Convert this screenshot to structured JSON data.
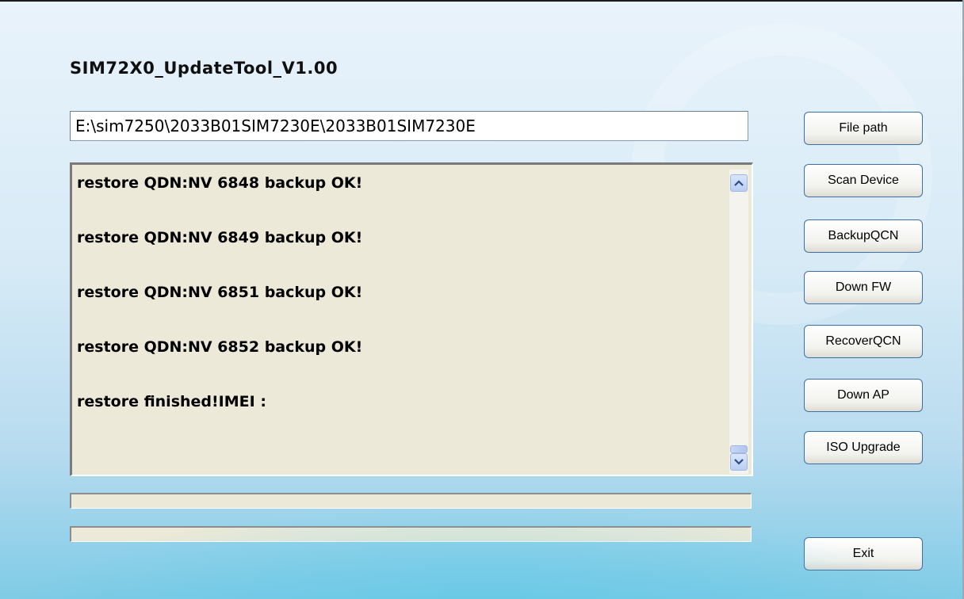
{
  "window": {
    "title": "SIM72X0_UpdateTool_V1.00"
  },
  "path_field": {
    "value": "E:\\sim7250\\2033B01SIM7230E\\2033B01SIM7230E"
  },
  "log": {
    "lines": [
      "restore QDN:NV 6848 backup OK!",
      "restore QDN:NV 6849 backup OK!",
      "restore QDN:NV 6851 backup OK!",
      "restore QDN:NV 6852 backup OK!",
      "restore finished!IMEI :"
    ]
  },
  "progress": {
    "bar1_percent": 0,
    "bar2_percent": 0
  },
  "buttons": {
    "file_path": "File path",
    "scan_device": "Scan Device",
    "backup_qcn": "BackupQCN",
    "down_fw": "Down FW",
    "recover_qcn": "RecoverQCN",
    "down_ap": "Down AP",
    "iso_upgrade": "ISO Upgrade",
    "exit": "Exit"
  },
  "icons": {
    "scroll_up": "scroll-up-arrow-icon",
    "scroll_down": "scroll-down-arrow-icon"
  },
  "colors": {
    "background_top": "#e9f3fb",
    "background_bottom": "#7fcbe6",
    "log_background": "#ece9d8",
    "button_border": "#3c6fa8"
  }
}
